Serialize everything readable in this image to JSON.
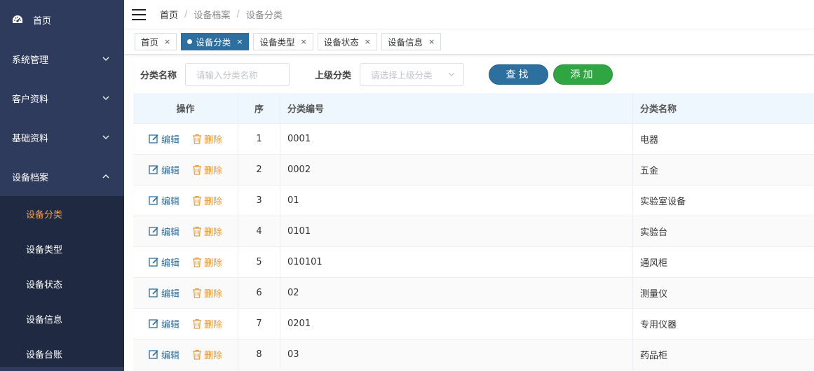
{
  "sidebar": {
    "home": {
      "label": "首页",
      "icon": "dashboard-icon"
    },
    "groups": [
      {
        "label": "系统管理",
        "expanded": false
      },
      {
        "label": "客户资料",
        "expanded": false
      },
      {
        "label": "基础资料",
        "expanded": false
      },
      {
        "label": "设备档案",
        "expanded": true
      }
    ],
    "sub_items": [
      "设备分类",
      "设备类型",
      "设备状态",
      "设备信息",
      "设备台账"
    ],
    "active_sub": "设备分类"
  },
  "breadcrumb": {
    "home": "首页",
    "sep": "/",
    "level1": "设备档案",
    "level2": "设备分类"
  },
  "tabs": [
    {
      "label": "首页",
      "active": false,
      "close": "×"
    },
    {
      "label": "设备分类",
      "active": true,
      "close": "×"
    },
    {
      "label": "设备类型",
      "active": false,
      "close": "×"
    },
    {
      "label": "设备状态",
      "active": false,
      "close": "×"
    },
    {
      "label": "设备信息",
      "active": false,
      "close": "×"
    }
  ],
  "filter": {
    "name_label": "分类名称",
    "name_placeholder": "请输入分类名称",
    "parent_label": "上级分类",
    "parent_placeholder": "请选择上级分类",
    "search_button": "查找",
    "add_button": "添加"
  },
  "table": {
    "headers": {
      "op": "操作",
      "no": "序",
      "code": "分类编号",
      "name": "分类名称"
    },
    "edit_label": "编辑",
    "delete_label": "删除",
    "rows": [
      {
        "no": "1",
        "code": "0001",
        "name": "电器"
      },
      {
        "no": "2",
        "code": "0002",
        "name": "五金"
      },
      {
        "no": "3",
        "code": "01",
        "name": "实验室设备"
      },
      {
        "no": "4",
        "code": "0101",
        "name": "实验台"
      },
      {
        "no": "5",
        "code": "010101",
        "name": "通风柜"
      },
      {
        "no": "6",
        "code": "02",
        "name": "测量仪"
      },
      {
        "no": "7",
        "code": "0201",
        "name": "专用仪器"
      },
      {
        "no": "8",
        "code": "03",
        "name": "药品柜"
      }
    ]
  },
  "colors": {
    "sidebar_bg": "#2f3b5c",
    "submenu_bg": "#1f2941",
    "active_sub": "#f5a04a",
    "primary": "#2d6f9f",
    "add_green": "#2fa641",
    "delete_orange": "#e69a3e"
  }
}
